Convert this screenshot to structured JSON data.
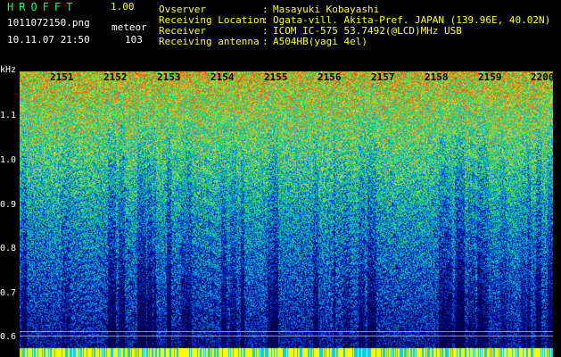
{
  "header": {
    "app_title": "HROFFT",
    "app_version": "1.00",
    "filename": "1011072150.png",
    "datetime": "10.11.07 21:50",
    "event_type": "meteor",
    "event_count": "103",
    "meta": [
      {
        "label": "Ovserver",
        "value": "Masayuki Kobayashi"
      },
      {
        "label": "Receiving Location",
        "value": "Ogata-vill. Akita-Pref. JAPAN (139.96E, 40.02N)"
      },
      {
        "label": "Receiver",
        "value": "ICOM IC-575 53.7492(@LCD)MHz USB"
      },
      {
        "label": "Receiving antenna",
        "value": "A504HB(yagi 4el)"
      }
    ]
  },
  "spectrogram": {
    "unit_label": "kHz",
    "freq_ticks": [
      "1.1",
      "1.0",
      "0.9",
      "0.8",
      "0.7",
      "0.6"
    ],
    "time_ticks": [
      "2151",
      "2152",
      "2153",
      "2154",
      "2155",
      "2156",
      "2157",
      "2158",
      "2159",
      "2200"
    ],
    "colors": {
      "low": "#000080",
      "mid": "#00c8c8",
      "high": "#ff4000",
      "baseline": "#ffff00"
    }
  }
}
